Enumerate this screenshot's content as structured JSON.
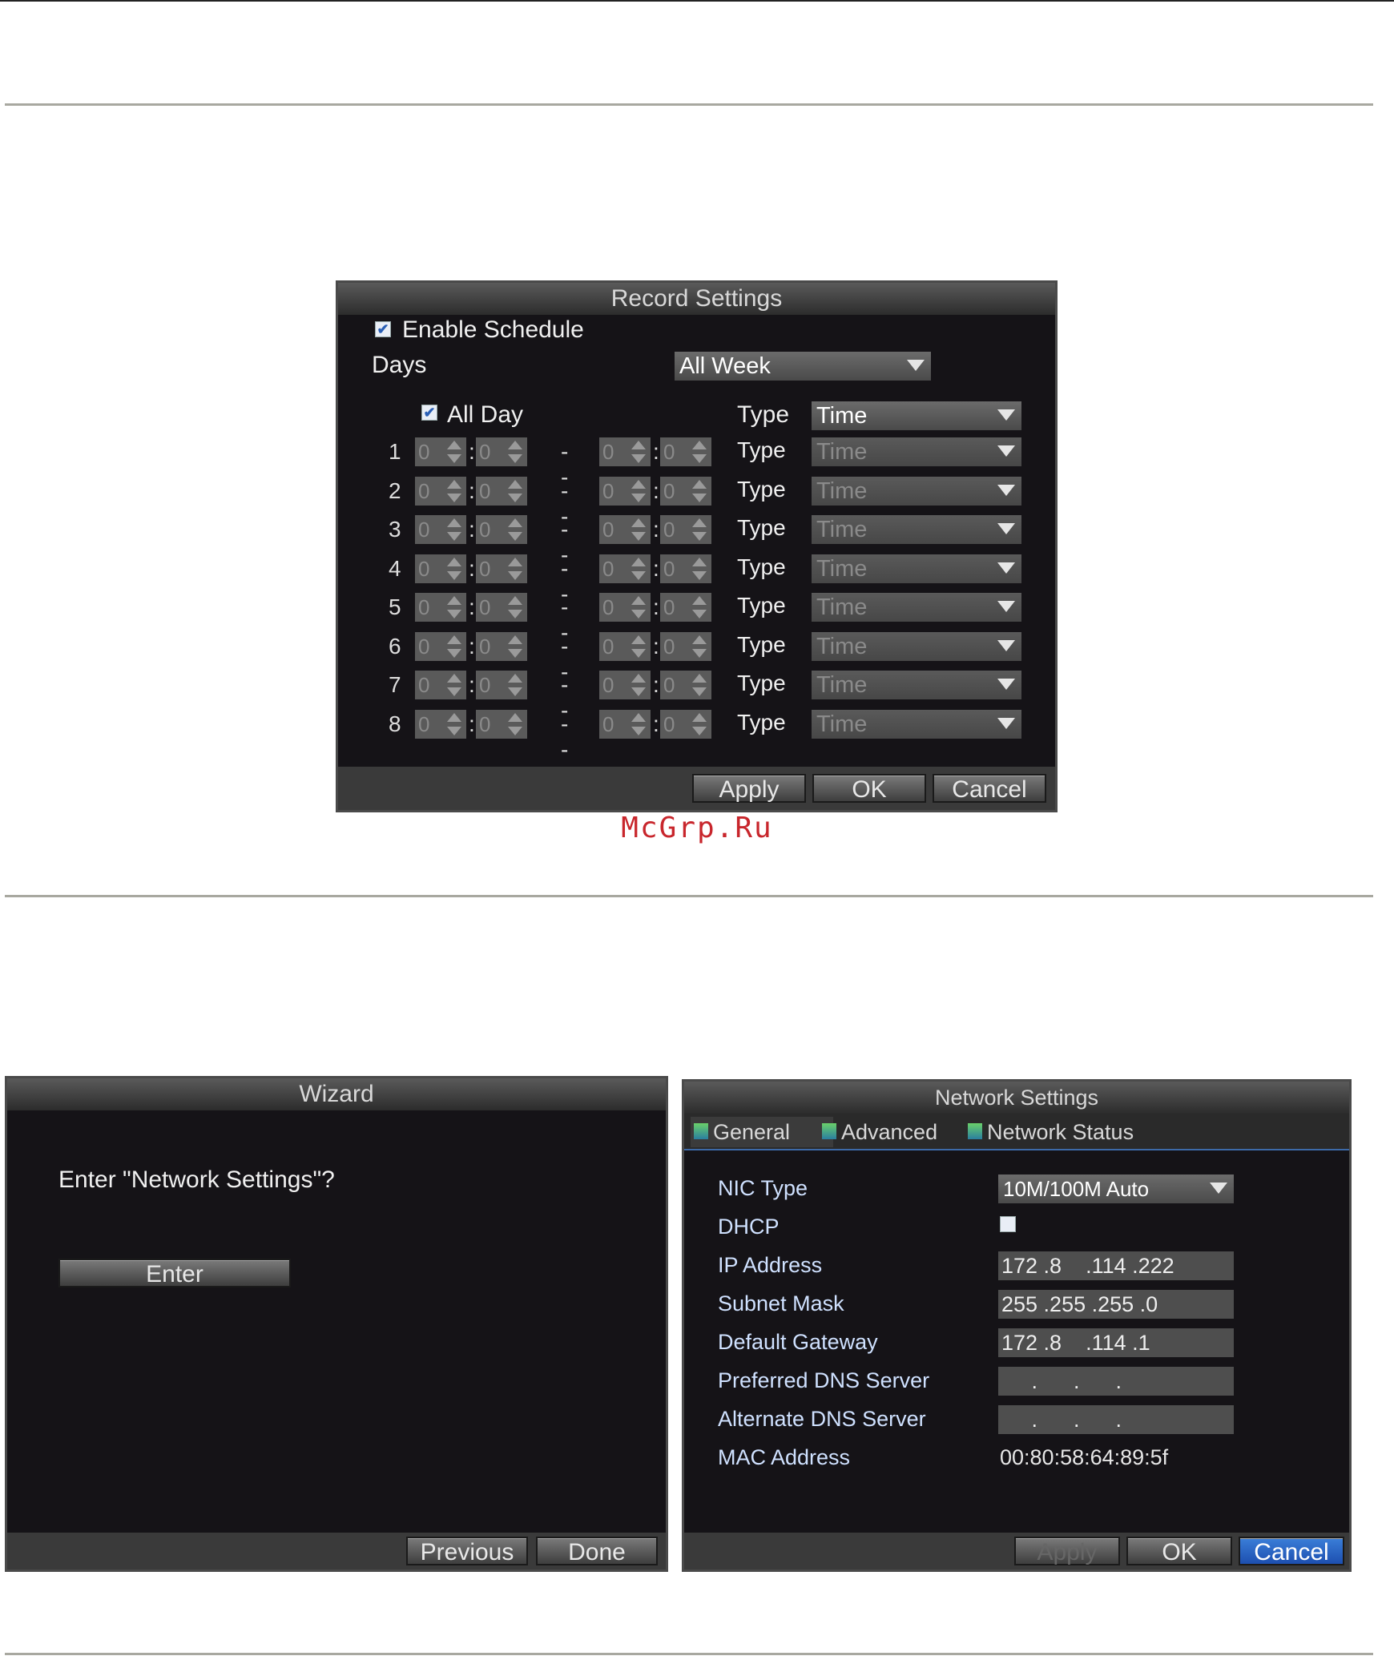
{
  "record": {
    "title": "Record Settings",
    "enable_schedule": "Enable Schedule",
    "days_label": "Days",
    "days_value": "All Week",
    "all_day": "All Day",
    "type_label": "Type",
    "type_value": "Time",
    "rows": [
      {
        "num": "1",
        "h1": "0",
        "m1": "0",
        "h2": "0",
        "m2": "0",
        "type": "Type",
        "value": "Time"
      },
      {
        "num": "2",
        "h1": "0",
        "m1": "0",
        "h2": "0",
        "m2": "0",
        "type": "Type",
        "value": "Time"
      },
      {
        "num": "3",
        "h1": "0",
        "m1": "0",
        "h2": "0",
        "m2": "0",
        "type": "Type",
        "value": "Time"
      },
      {
        "num": "4",
        "h1": "0",
        "m1": "0",
        "h2": "0",
        "m2": "0",
        "type": "Type",
        "value": "Time"
      },
      {
        "num": "5",
        "h1": "0",
        "m1": "0",
        "h2": "0",
        "m2": "0",
        "type": "Type",
        "value": "Time"
      },
      {
        "num": "6",
        "h1": "0",
        "m1": "0",
        "h2": "0",
        "m2": "0",
        "type": "Type",
        "value": "Time"
      },
      {
        "num": "7",
        "h1": "0",
        "m1": "0",
        "h2": "0",
        "m2": "0",
        "type": "Type",
        "value": "Time"
      },
      {
        "num": "8",
        "h1": "0",
        "m1": "0",
        "h2": "0",
        "m2": "0",
        "type": "Type",
        "value": "Time"
      }
    ],
    "apply": "Apply",
    "ok": "OK",
    "cancel": "Cancel"
  },
  "watermark": "McGrp.Ru",
  "wizard": {
    "title": "Wizard",
    "question": "Enter \"Network Settings\"?",
    "enter": "Enter",
    "previous": "Previous",
    "done": "Done"
  },
  "network": {
    "title": "Network Settings",
    "tabs": [
      "General",
      "Advanced",
      "Network Status"
    ],
    "nic_type_label": "NIC Type",
    "nic_type_value": "10M/100M Auto",
    "dhcp_label": "DHCP",
    "ip_label": "IP Address",
    "ip_value": "172 .8    .114 .222",
    "subnet_label": "Subnet Mask",
    "subnet_value": "255 .255 .255 .0",
    "gateway_label": "Default Gateway",
    "gateway_value": "172 .8    .114 .1",
    "pdns_label": "Preferred DNS Server",
    "pdns_value": "     .      .      .",
    "adns_label": "Alternate DNS Server",
    "adns_value": "     .      .      .",
    "mac_label": "MAC Address",
    "mac_value": "00:80:58:64:89:5f",
    "apply": "Apply",
    "ok": "OK",
    "cancel": "Cancel"
  }
}
